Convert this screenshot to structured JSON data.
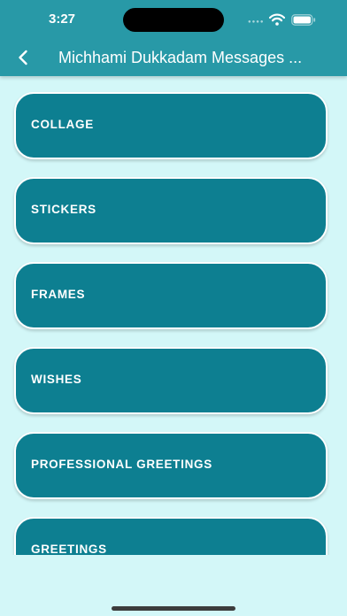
{
  "status_bar": {
    "time": "3:27",
    "icons": [
      "cellular-signal-icon",
      "wifi-icon",
      "battery-icon"
    ]
  },
  "app_bar": {
    "title": "Michhami Dukkadam Messages ...",
    "back_icon": "chevron-left-icon"
  },
  "menu": {
    "items": [
      {
        "label": "COLLAGE"
      },
      {
        "label": "STICKERS"
      },
      {
        "label": "FRAMES"
      },
      {
        "label": "WISHES"
      },
      {
        "label": "PROFESSIONAL GREETINGS"
      },
      {
        "label": "GREETINGS"
      }
    ]
  },
  "colors": {
    "app_bar": "#2899a7",
    "card": "#0d7f91",
    "background": "#d3f7f8",
    "card_border": "#ffffff"
  }
}
